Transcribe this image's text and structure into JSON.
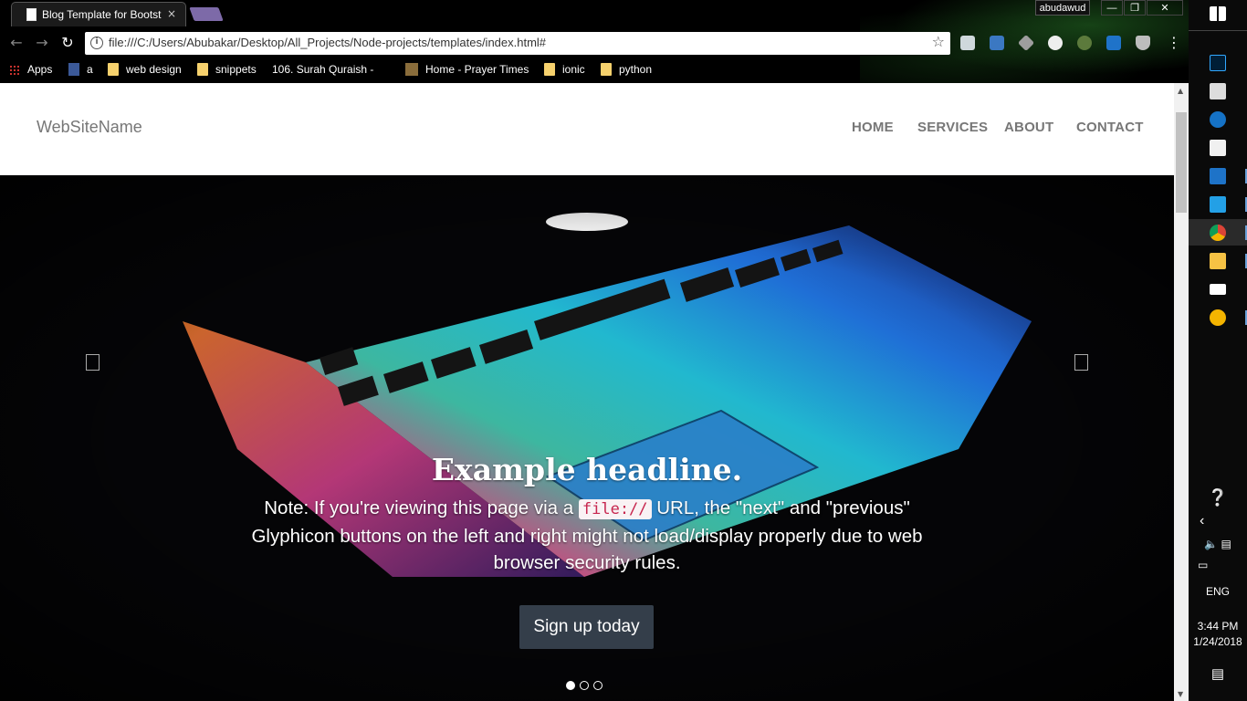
{
  "browser": {
    "tab_title": "Blog Template for Bootst",
    "tab_close": "×",
    "user_badge": "abudawud",
    "url": "file:///C:/Users/Abubakar/Desktop/All_Projects/Node-projects/templates/index.html#",
    "bookmarks": [
      {
        "label": "Apps",
        "icon": "apps-grid-icon"
      },
      {
        "label": "a",
        "icon": "facebook-icon"
      },
      {
        "label": "web design",
        "icon": "folder-icon"
      },
      {
        "label": "snippets",
        "icon": "folder-icon"
      },
      {
        "label": "106. Surah Quraish -",
        "icon": "page-icon"
      },
      {
        "label": "Home - Prayer Times",
        "icon": "mosque-icon"
      },
      {
        "label": "ionic",
        "icon": "folder-icon"
      },
      {
        "label": "python",
        "icon": "folder-icon"
      }
    ]
  },
  "site": {
    "brand": "WebSiteName",
    "nav": [
      "HOME",
      "SERVICES",
      "ABOUT",
      "CONTACT"
    ]
  },
  "carousel": {
    "headline": "Example headline.",
    "text_before": "Note: If you're viewing this page via a ",
    "code": "file://",
    "text_after": " URL, the \"next\" and \"previous\" Glyphicon buttons on the left and right might not load/display properly due to web browser security rules.",
    "button": "Sign up today",
    "slide_count": 3,
    "active_slide": 1
  },
  "taskbar": {
    "language": "ENG",
    "time": "3:44 PM",
    "date": "1/24/2018"
  },
  "colors": {
    "brand_text": "#777777",
    "signup_button": "#343e4a",
    "code_text": "#c7254e"
  }
}
